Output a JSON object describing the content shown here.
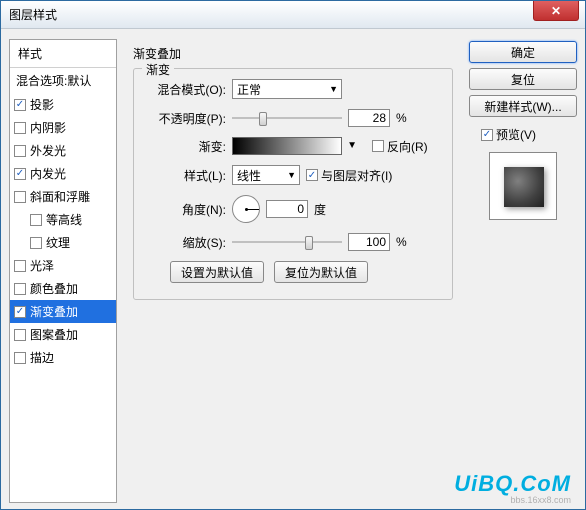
{
  "window": {
    "title": "图层样式"
  },
  "left": {
    "header": "样式",
    "subtitle": "混合选项:默认",
    "items": [
      {
        "label": "投影",
        "checked": true
      },
      {
        "label": "内阴影",
        "checked": false
      },
      {
        "label": "外发光",
        "checked": false
      },
      {
        "label": "内发光",
        "checked": true
      },
      {
        "label": "斜面和浮雕",
        "checked": false
      },
      {
        "label": "等高线",
        "checked": false,
        "indent": true
      },
      {
        "label": "纹理",
        "checked": false,
        "indent": true
      },
      {
        "label": "光泽",
        "checked": false
      },
      {
        "label": "颜色叠加",
        "checked": false
      },
      {
        "label": "渐变叠加",
        "checked": true,
        "selected": true
      },
      {
        "label": "图案叠加",
        "checked": false
      },
      {
        "label": "描边",
        "checked": false
      }
    ]
  },
  "center": {
    "title": "渐变叠加",
    "fieldset": "渐变",
    "blend_label": "混合模式(O):",
    "blend_value": "正常",
    "opacity_label": "不透明度(P):",
    "opacity_value": "28",
    "opacity_pct": 28,
    "gradient_label": "渐变:",
    "reverse_label": "反向(R)",
    "reverse_checked": false,
    "style_label": "样式(L):",
    "style_value": "线性",
    "align_label": "与图层对齐(I)",
    "align_checked": true,
    "angle_label": "角度(N):",
    "angle_value": "0",
    "angle_unit": "度",
    "scale_label": "缩放(S):",
    "scale_value": "100",
    "scale_pct": 70,
    "pct": "%",
    "btn_default": "设置为默认值",
    "btn_reset": "复位为默认值"
  },
  "right": {
    "ok": "确定",
    "cancel": "复位",
    "new_style": "新建样式(W)...",
    "preview_label": "预览(V)",
    "preview_checked": true
  },
  "watermark": {
    "main": "UiBQ.CoM",
    "sub": "bbs.16xx8.com"
  }
}
